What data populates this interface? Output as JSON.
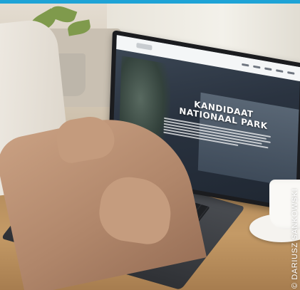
{
  "screen": {
    "hero_title_line1": "KANDIDAAT",
    "hero_title_line2": "NATIONAAL PARK"
  },
  "credit": {
    "text": "© DARIUSZ SANKOWSKI"
  },
  "colors": {
    "top_strip": "#1ea3d6",
    "hero_title": "#ffffff"
  }
}
